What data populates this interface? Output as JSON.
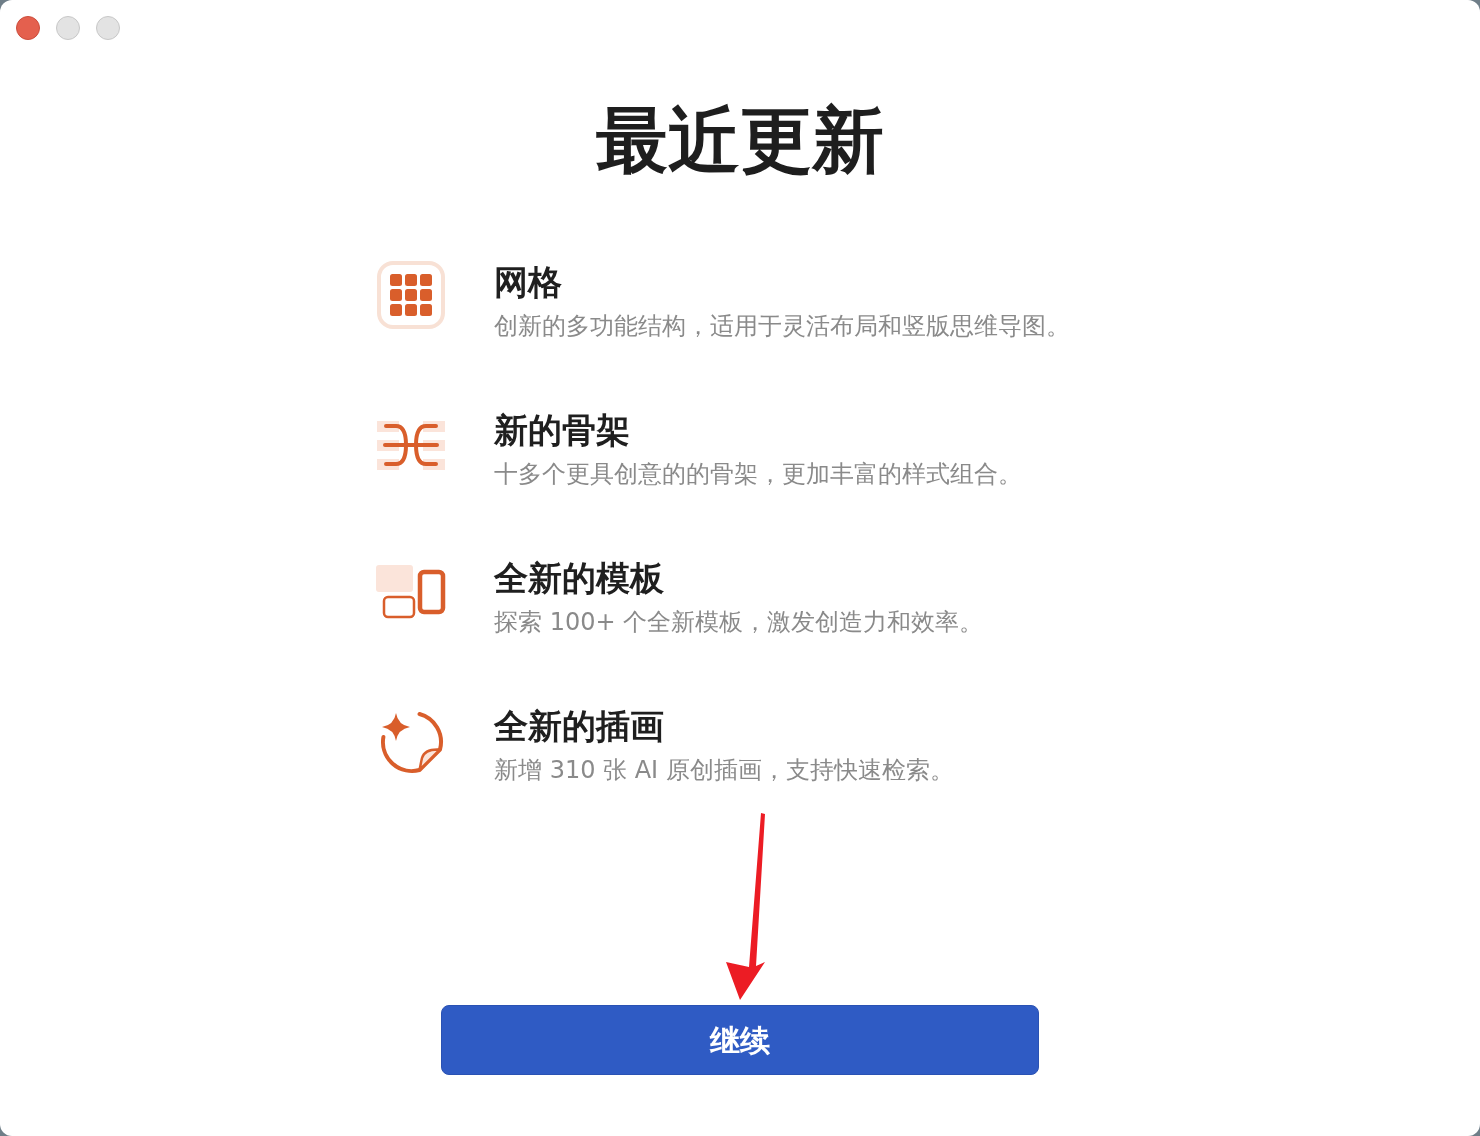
{
  "window": {
    "controls": [
      {
        "kind": "close",
        "disabled": false
      },
      {
        "kind": "minimize",
        "disabled": true
      },
      {
        "kind": "zoom",
        "disabled": true
      }
    ]
  },
  "title": "最近更新",
  "features": [
    {
      "kind": "grid",
      "title": "网格",
      "description": "创新的多功能结构，适用于灵活布局和竖版思维导图。"
    },
    {
      "kind": "skeleton",
      "title": "新的骨架",
      "description": "十多个更具创意的的骨架，更加丰富的样式组合。"
    },
    {
      "kind": "template",
      "title": "全新的模板",
      "description": "探索 100+ 个全新模板，激发创造力和效率。"
    },
    {
      "kind": "illustration",
      "title": "全新的插画",
      "description": "新增 310 张 AI 原创插画，支持快速检索。"
    }
  ],
  "button": {
    "label": "继续"
  }
}
